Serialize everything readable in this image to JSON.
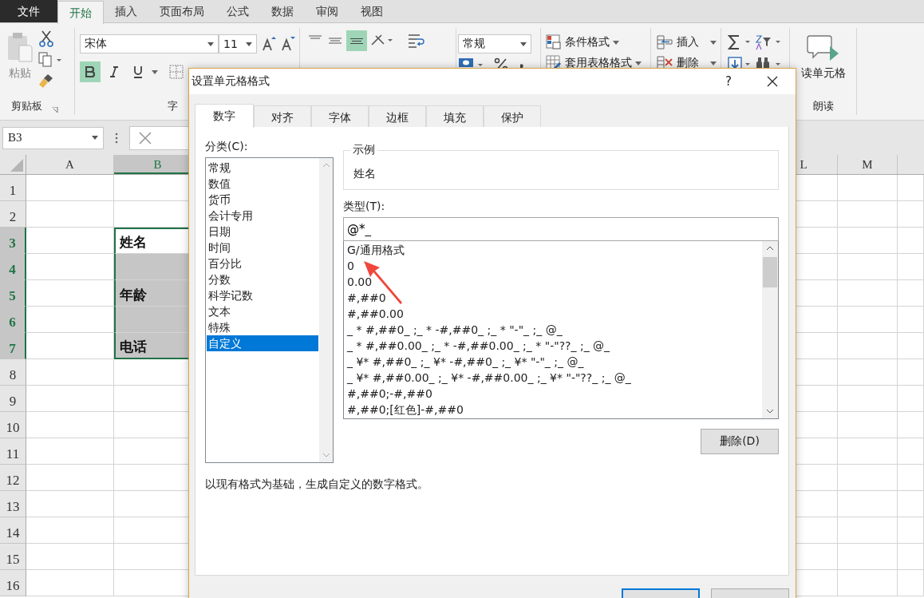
{
  "ribbon_tabs": [
    {
      "label": "文件",
      "kind": "file",
      "selected": false
    },
    {
      "label": "开始",
      "kind": "tab",
      "selected": true
    },
    {
      "label": "插入",
      "kind": "tab",
      "selected": false
    },
    {
      "label": "页面布局",
      "kind": "tab",
      "selected": false
    },
    {
      "label": "公式",
      "kind": "tab",
      "selected": false
    },
    {
      "label": "数据",
      "kind": "tab",
      "selected": false
    },
    {
      "label": "审阅",
      "kind": "tab",
      "selected": false
    },
    {
      "label": "视图",
      "kind": "tab",
      "selected": false
    }
  ],
  "ribbon": {
    "paste": "粘贴",
    "clipboard_group": "剪贴板",
    "font_name": "宋体",
    "font_size": "11",
    "bold": true,
    "italic": false,
    "underline": false,
    "font_group": "字",
    "align_bottom": true,
    "number_format": "常规",
    "conditional_format": "条件格式",
    "table_format": "套用表格格式",
    "insert": "插入",
    "delete": "删除",
    "read_cell": "读单元格",
    "read_group": "朗读"
  },
  "name_box": "B3",
  "sheet": {
    "columns": [
      {
        "label": "A",
        "selected": false
      },
      {
        "label": "B",
        "selected": true
      },
      {
        "label": "L",
        "selected": false
      },
      {
        "label": "M",
        "selected": false
      }
    ],
    "rows": [
      {
        "label": "1",
        "selected": false,
        "shaded": false
      },
      {
        "label": "2",
        "selected": false,
        "shaded": false
      },
      {
        "label": "3",
        "selected": true,
        "shaded": false,
        "b": "姓名"
      },
      {
        "label": "4",
        "selected": true,
        "shaded": true
      },
      {
        "label": "5",
        "selected": true,
        "shaded": true,
        "b": "年龄"
      },
      {
        "label": "6",
        "selected": true,
        "shaded": true
      },
      {
        "label": "7",
        "selected": true,
        "shaded": true,
        "b": "电话"
      },
      {
        "label": "8",
        "selected": false,
        "shaded": false
      },
      {
        "label": "9",
        "selected": false,
        "shaded": false
      },
      {
        "label": "10",
        "selected": false,
        "shaded": false
      },
      {
        "label": "11",
        "selected": false,
        "shaded": false
      },
      {
        "label": "12",
        "selected": false,
        "shaded": false
      },
      {
        "label": "13",
        "selected": false,
        "shaded": false
      },
      {
        "label": "14",
        "selected": false,
        "shaded": false
      },
      {
        "label": "15",
        "selected": false,
        "shaded": false
      },
      {
        "label": "16",
        "selected": false,
        "shaded": false
      }
    ]
  },
  "dialog": {
    "title": "设置单元格格式",
    "help": "?",
    "tabs": [
      {
        "label": "数字",
        "selected": true
      },
      {
        "label": "对齐",
        "selected": false
      },
      {
        "label": "字体",
        "selected": false
      },
      {
        "label": "边框",
        "selected": false
      },
      {
        "label": "填充",
        "selected": false
      },
      {
        "label": "保护",
        "selected": false
      }
    ],
    "category_label": "分类(C):",
    "categories": [
      {
        "label": "常规",
        "selected": false
      },
      {
        "label": "数值",
        "selected": false
      },
      {
        "label": "货币",
        "selected": false
      },
      {
        "label": "会计专用",
        "selected": false
      },
      {
        "label": "日期",
        "selected": false
      },
      {
        "label": "时间",
        "selected": false
      },
      {
        "label": "百分比",
        "selected": false
      },
      {
        "label": "分数",
        "selected": false
      },
      {
        "label": "科学记数",
        "selected": false
      },
      {
        "label": "文本",
        "selected": false
      },
      {
        "label": "特殊",
        "selected": false
      },
      {
        "label": "自定义",
        "selected": true
      }
    ],
    "sample_label": "示例",
    "sample_value": "姓名",
    "type_label": "类型(T):",
    "type_value": "@*_",
    "formats": [
      "G/通用格式",
      "0",
      "0.00",
      "#,##0",
      "#,##0.00",
      "_ * #,##0_ ;_ * -#,##0_ ;_ * \"-\"_ ;_ @_",
      "_ * #,##0.00_ ;_ * -#,##0.00_ ;_ * \"-\"??_ ;_ @_",
      "_ ¥* #,##0_ ;_ ¥* -#,##0_ ;_ ¥* \"-\"_ ;_ @_",
      "_ ¥* #,##0.00_ ;_ ¥* -#,##0.00_ ;_ ¥* \"-\"??_ ;_ @_",
      "#,##0;-#,##0",
      "#,##0;[红色]-#,##0"
    ],
    "delete_button": "删除(D)",
    "description": "以现有格式为基础，生成自定义的数字格式。"
  }
}
